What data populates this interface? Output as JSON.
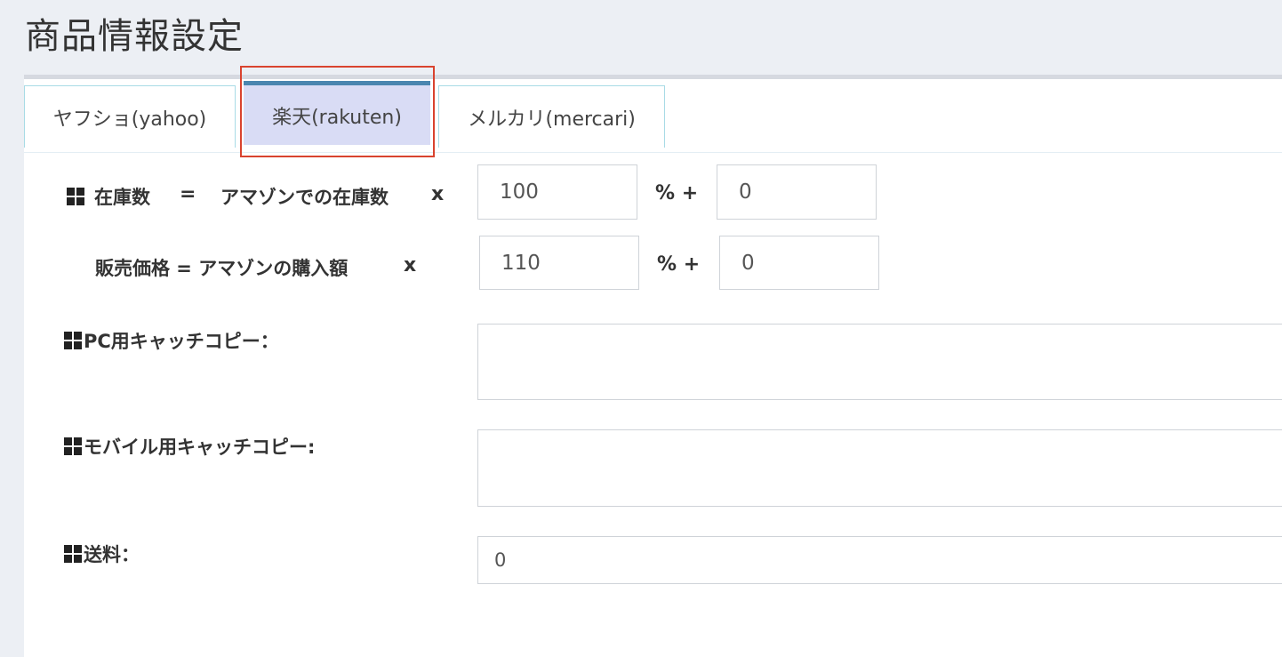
{
  "page": {
    "title": "商品情報設定"
  },
  "tabs": [
    {
      "label": "ヤフショ(yahoo)",
      "active": false
    },
    {
      "label": "楽天(rakuten)",
      "active": true
    },
    {
      "label": "メルカリ(mercari)",
      "active": false
    }
  ],
  "form": {
    "stock": {
      "label": "在庫数",
      "equals": "=",
      "source": "アマゾンでの在庫数",
      "times": "x",
      "percent_value": "100",
      "percent_plus": "% +",
      "add_value": "0"
    },
    "price": {
      "label": "販売価格 = アマゾンの購入額",
      "times": "x",
      "percent_value": "110",
      "percent_plus": "% +",
      "add_value": "0"
    },
    "pc_catch": {
      "label": "PC用キャッチコピー：",
      "value": ""
    },
    "mobile_catch": {
      "label": "モバイル用キャッチコピー:",
      "value": ""
    },
    "shipping": {
      "label": "送料：",
      "value": "0"
    }
  },
  "colors": {
    "active_tab_bg": "#d9dcf5",
    "active_tab_top": "#4a86b0",
    "tab_border": "#a8dbe6",
    "highlight": "#d9432f"
  }
}
